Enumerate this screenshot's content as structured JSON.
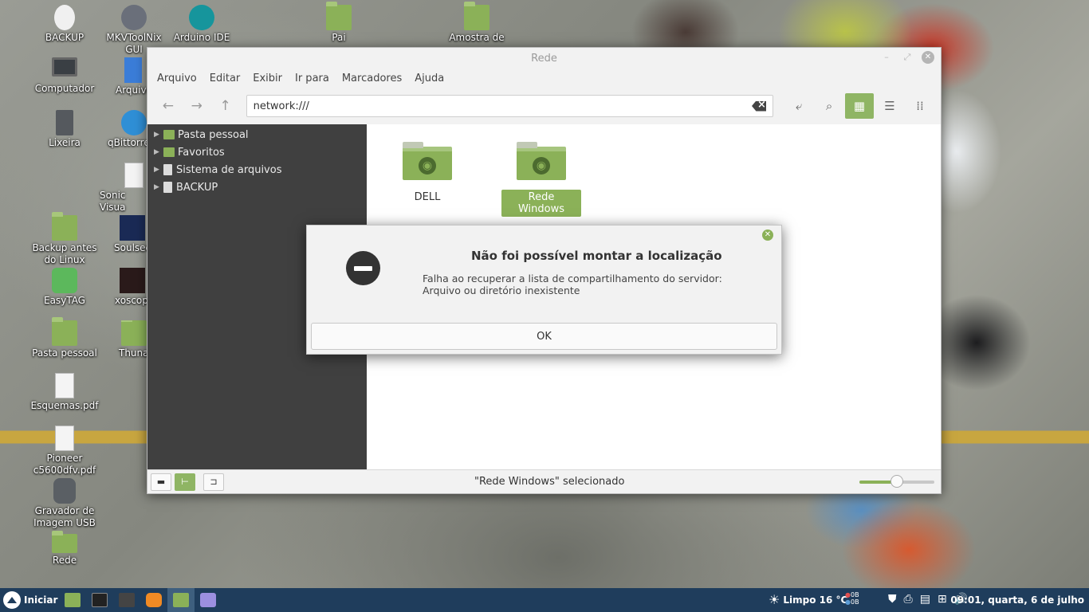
{
  "desktop": {
    "icons": [
      {
        "label": "BACKUP"
      },
      {
        "label": "MKVToolNix GUI"
      },
      {
        "label": "Arduino IDE"
      },
      {
        "label": "Pai"
      },
      {
        "label": "Amostra de"
      },
      {
        "label": "Computador"
      },
      {
        "label": "Arquivo"
      },
      {
        "label": "Lixeira"
      },
      {
        "label": "qBittorre"
      },
      {
        "label": "Sonic Visua"
      },
      {
        "label": "Backup antes do Linux"
      },
      {
        "label": "Soulsee"
      },
      {
        "label": "EasyTAG"
      },
      {
        "label": "xoscope"
      },
      {
        "label": "Pasta pessoal"
      },
      {
        "label": "Thuna"
      },
      {
        "label": "Esquemas.pdf"
      },
      {
        "label": "Pioneer c5600dfv.pdf"
      },
      {
        "label": "Gravador de Imagem USB"
      },
      {
        "label": "Rede"
      }
    ]
  },
  "window": {
    "title": "Rede",
    "menu": [
      "Arquivo",
      "Editar",
      "Exibir",
      "Ir para",
      "Marcadores",
      "Ajuda"
    ],
    "location": "network:///",
    "sidebar": [
      {
        "label": "Pasta pessoal",
        "icon": "home-folder-icon"
      },
      {
        "label": "Favoritos",
        "icon": "star-folder-icon"
      },
      {
        "label": "Sistema de arquivos",
        "icon": "drive-icon"
      },
      {
        "label": "BACKUP",
        "icon": "drive-icon"
      }
    ],
    "items": [
      {
        "label": "DELL",
        "selected": false
      },
      {
        "label": "Rede Windows",
        "selected": true
      }
    ],
    "status": "\"Rede Windows\" selecionado",
    "zoom_fraction": 0.5
  },
  "dialog": {
    "title": "Não foi possível montar a localização",
    "message": "Falha ao recuperar a lista de compartilhamento do servidor: Arquivo ou diretório inexistente",
    "ok": "OK"
  },
  "taskbar": {
    "start_label": "Iniciar",
    "weather": "Limpo 16 °C",
    "net_up": "0B",
    "net_down": "0B",
    "clock": "09:01, quarta,  6 de julho"
  },
  "colors": {
    "accent": "#8bb158",
    "sidebar_bg": "#404040",
    "taskbar_bg": "#1f3d5c"
  }
}
